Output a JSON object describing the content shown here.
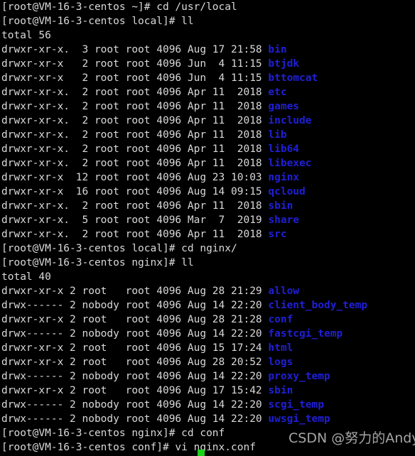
{
  "terminal": {
    "background_color": "#000000",
    "foreground_color": "#d9d9d9",
    "directory_color": "#1f1fd8",
    "cursor_color": "#19d219",
    "hostname": "VM-16-3-centos",
    "user": "root",
    "lines": [
      {
        "text": "[root@VM-16-3-centos ~]# cd /usr/local",
        "kind": "prompt"
      },
      {
        "text": "[root@VM-16-3-centos local]# ll",
        "kind": "prompt"
      },
      {
        "text": "total 56",
        "kind": "output"
      },
      {
        "text": "drwxr-xr-x.  3 root root 4096 Aug 17 21:58 ",
        "dir": "bin",
        "kind": "listing"
      },
      {
        "text": "drwxr-xr-x   2 root root 4096 Jun  4 11:15 ",
        "dir": "btjdk",
        "kind": "listing"
      },
      {
        "text": "drwxr-xr-x   2 root root 4096 Jun  4 11:15 ",
        "dir": "bttomcat",
        "kind": "listing"
      },
      {
        "text": "drwxr-xr-x.  2 root root 4096 Apr 11  2018 ",
        "dir": "etc",
        "kind": "listing"
      },
      {
        "text": "drwxr-xr-x.  2 root root 4096 Apr 11  2018 ",
        "dir": "games",
        "kind": "listing"
      },
      {
        "text": "drwxr-xr-x.  2 root root 4096 Apr 11  2018 ",
        "dir": "include",
        "kind": "listing"
      },
      {
        "text": "drwxr-xr-x.  2 root root 4096 Apr 11  2018 ",
        "dir": "lib",
        "kind": "listing"
      },
      {
        "text": "drwxr-xr-x.  2 root root 4096 Apr 11  2018 ",
        "dir": "lib64",
        "kind": "listing"
      },
      {
        "text": "drwxr-xr-x.  2 root root 4096 Apr 11  2018 ",
        "dir": "libexec",
        "kind": "listing"
      },
      {
        "text": "drwxr-xr-x  12 root root 4096 Aug 23 10:03 ",
        "dir": "nginx",
        "kind": "listing"
      },
      {
        "text": "drwxr-xr-x  16 root root 4096 Aug 14 09:15 ",
        "dir": "qcloud",
        "kind": "listing"
      },
      {
        "text": "drwxr-xr-x.  2 root root 4096 Apr 11  2018 ",
        "dir": "sbin",
        "kind": "listing"
      },
      {
        "text": "drwxr-xr-x.  5 root root 4096 Mar  7  2019 ",
        "dir": "share",
        "kind": "listing"
      },
      {
        "text": "drwxr-xr-x.  2 root root 4096 Apr 11  2018 ",
        "dir": "src",
        "kind": "listing"
      },
      {
        "text": "[root@VM-16-3-centos local]# cd nginx/",
        "kind": "prompt"
      },
      {
        "text": "[root@VM-16-3-centos nginx]# ll",
        "kind": "prompt"
      },
      {
        "text": "total 40",
        "kind": "output"
      },
      {
        "text": "drwxr-xr-x 2 root   root 4096 Aug 28 21:29 ",
        "dir": "allow",
        "kind": "listing"
      },
      {
        "text": "drwx------ 2 nobody root 4096 Aug 14 22:20 ",
        "dir": "client_body_temp",
        "kind": "listing"
      },
      {
        "text": "drwxr-xr-x 2 root   root 4096 Aug 28 21:28 ",
        "dir": "conf",
        "kind": "listing"
      },
      {
        "text": "drwx------ 2 nobody root 4096 Aug 14 22:20 ",
        "dir": "fastcgi_temp",
        "kind": "listing"
      },
      {
        "text": "drwxr-xr-x 2 root   root 4096 Aug 15 17:24 ",
        "dir": "html",
        "kind": "listing"
      },
      {
        "text": "drwxr-xr-x 2 root   root 4096 Aug 28 20:52 ",
        "dir": "logs",
        "kind": "listing"
      },
      {
        "text": "drwx------ 2 nobody root 4096 Aug 14 22:20 ",
        "dir": "proxy_temp",
        "kind": "listing"
      },
      {
        "text": "drwxr-xr-x 2 root   root 4096 Aug 17 15:42 ",
        "dir": "sbin",
        "kind": "listing"
      },
      {
        "text": "drwx------ 2 nobody root 4096 Aug 14 22:20 ",
        "dir": "scgi_temp",
        "kind": "listing"
      },
      {
        "text": "drwx------ 2 nobody root 4096 Aug 14 22:20 ",
        "dir": "uwsgi_temp",
        "kind": "listing"
      },
      {
        "text": "[root@VM-16-3-centos nginx]# cd conf",
        "kind": "prompt"
      },
      {
        "text": "[root@VM-16-3-centos conf]# vi nginx.conf",
        "kind": "prompt"
      }
    ],
    "watermark": "CSDN @努力的Andy"
  }
}
